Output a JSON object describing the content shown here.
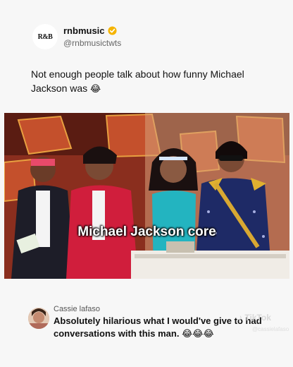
{
  "post": {
    "avatar_text": "R&B",
    "display_name": "rnbmusic",
    "handle": "@rnbmusictwts",
    "text": "Not enough people talk about how funny Michael Jackson was",
    "text_emoji": "😂",
    "media_caption": "Michael Jackson core"
  },
  "comment": {
    "author": "Cassie lafaso",
    "text": "Absolutely hilarious what I would've give to had conversations with this man.",
    "emojis": "😂😂😂"
  },
  "watermark": {
    "brand": "TikTok",
    "handle": "@cassielafaso"
  },
  "colors": {
    "verified": "#f5b400",
    "background": "#f7f7f7"
  }
}
